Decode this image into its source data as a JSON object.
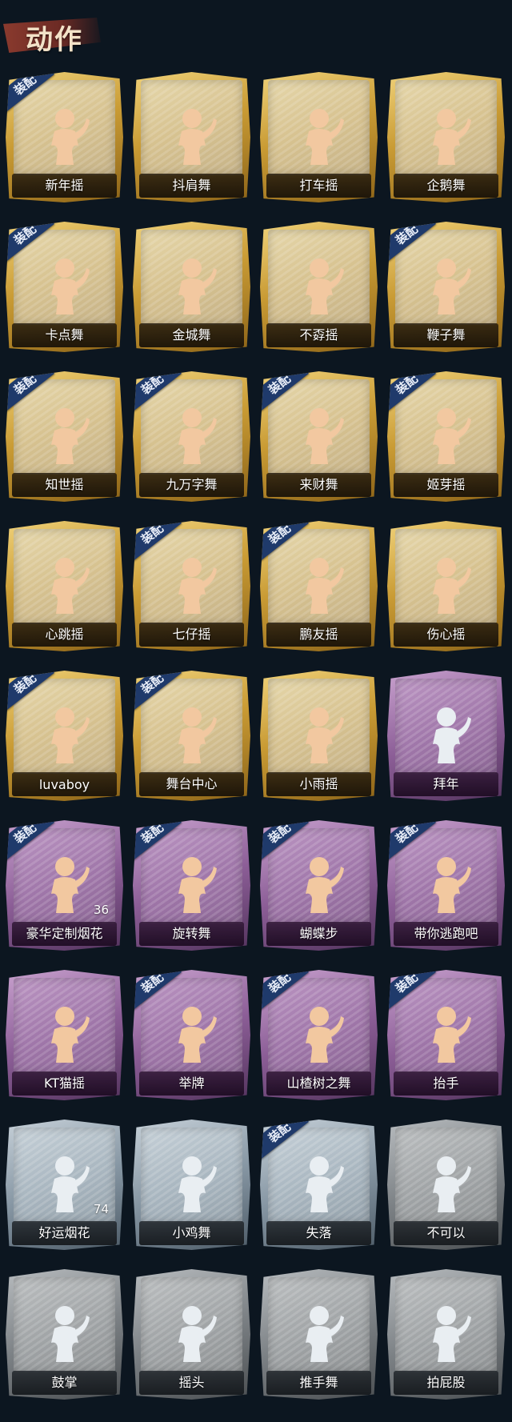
{
  "header": {
    "title": "动作"
  },
  "badge_text": "装配",
  "colors": {
    "gold": "#c99b34",
    "purple": "#8c5e97",
    "silver": "#8797a4",
    "grey": "#7d8286",
    "badge": "#1f3a6b",
    "figure_gold": "#f2c8a0",
    "figure_white": "#e9eef2"
  },
  "items": [
    {
      "label": "新年摇",
      "tier": "gold",
      "equipped": true,
      "icon": "dance-figure-icon"
    },
    {
      "label": "抖肩舞",
      "tier": "gold",
      "equipped": false,
      "icon": "dance-figure-icon"
    },
    {
      "label": "打车摇",
      "tier": "gold",
      "equipped": false,
      "icon": "dance-figure-icon"
    },
    {
      "label": "企鹅舞",
      "tier": "gold",
      "equipped": false,
      "icon": "dance-figure-icon"
    },
    {
      "label": "卡点舞",
      "tier": "gold",
      "equipped": true,
      "icon": "dance-figure-icon"
    },
    {
      "label": "金城舞",
      "tier": "gold",
      "equipped": false,
      "icon": "dance-figure-icon"
    },
    {
      "label": "不孬摇",
      "tier": "gold",
      "equipped": false,
      "icon": "dance-figure-icon"
    },
    {
      "label": "鞭子舞",
      "tier": "gold",
      "equipped": true,
      "icon": "dance-figure-icon"
    },
    {
      "label": "知世摇",
      "tier": "gold",
      "equipped": true,
      "icon": "dance-figure-icon"
    },
    {
      "label": "九万字舞",
      "tier": "gold",
      "equipped": true,
      "icon": "dance-figure-icon"
    },
    {
      "label": "来财舞",
      "tier": "gold",
      "equipped": true,
      "icon": "dance-figure-icon"
    },
    {
      "label": "姬芽摇",
      "tier": "gold",
      "equipped": true,
      "icon": "dance-figure-icon"
    },
    {
      "label": "心跳摇",
      "tier": "gold",
      "equipped": false,
      "icon": "dance-figure-icon"
    },
    {
      "label": "七仔摇",
      "tier": "gold",
      "equipped": true,
      "icon": "dance-figure-icon"
    },
    {
      "label": "鹏友摇",
      "tier": "gold",
      "equipped": true,
      "icon": "dance-figure-icon"
    },
    {
      "label": "伤心摇",
      "tier": "gold",
      "equipped": false,
      "icon": "heart-hands-figure-icon"
    },
    {
      "label": "luvaboy",
      "tier": "gold",
      "equipped": true,
      "icon": "dance-figure-icon"
    },
    {
      "label": "舞台中心",
      "tier": "gold",
      "equipped": true,
      "icon": "dance-figure-icon"
    },
    {
      "label": "小雨摇",
      "tier": "gold",
      "equipped": false,
      "icon": "dance-figure-icon"
    },
    {
      "label": "拜年",
      "tier": "purple",
      "equipped": false,
      "icon": "bow-figure-icon"
    },
    {
      "label": "豪华定制烟花",
      "tier": "purple",
      "equipped": true,
      "icon": "fireworks-box-icon",
      "count": "36"
    },
    {
      "label": "旋转舞",
      "tier": "purple",
      "equipped": true,
      "icon": "spin-figure-icon"
    },
    {
      "label": "蝴蝶步",
      "tier": "purple",
      "equipped": true,
      "icon": "dance-figure-icon"
    },
    {
      "label": "带你逃跑吧",
      "tier": "purple",
      "equipped": true,
      "icon": "dance-figure-icon"
    },
    {
      "label": "KT猫摇",
      "tier": "purple",
      "equipped": false,
      "icon": "dance-figure-icon"
    },
    {
      "label": "举牌",
      "tier": "purple",
      "equipped": true,
      "icon": "sign-figure-icon"
    },
    {
      "label": "山楂树之舞",
      "tier": "purple",
      "equipped": true,
      "icon": "dance-figure-icon"
    },
    {
      "label": "抬手",
      "tier": "purple",
      "equipped": true,
      "icon": "raise-hand-figure-icon"
    },
    {
      "label": "好运烟花",
      "tier": "silver",
      "equipped": false,
      "icon": "firework-can-icon",
      "count": "74"
    },
    {
      "label": "小鸡舞",
      "tier": "silver",
      "equipped": false,
      "icon": "dance-figure-icon"
    },
    {
      "label": "失落",
      "tier": "silver",
      "equipped": true,
      "icon": "crawl-figure-icon"
    },
    {
      "label": "不可以",
      "tier": "grey",
      "equipped": false,
      "icon": "finger-wag-icon"
    },
    {
      "label": "鼓掌",
      "tier": "grey",
      "equipped": false,
      "icon": "clap-hands-icon"
    },
    {
      "label": "摇头",
      "tier": "grey",
      "equipped": false,
      "icon": "dance-figure-icon"
    },
    {
      "label": "推手舞",
      "tier": "grey",
      "equipped": false,
      "icon": "dance-figure-icon"
    },
    {
      "label": "拍屁股",
      "tier": "grey",
      "equipped": false,
      "icon": "dance-figure-icon"
    }
  ]
}
